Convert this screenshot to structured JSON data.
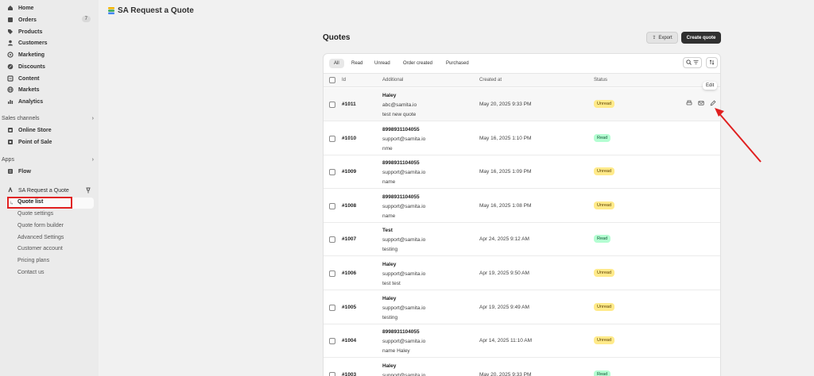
{
  "app": {
    "title": "SA Request a Quote"
  },
  "sidebar": {
    "items": [
      {
        "label": "Home",
        "icon": "home-icon"
      },
      {
        "label": "Orders",
        "icon": "orders-icon",
        "badge": "7"
      },
      {
        "label": "Products",
        "icon": "tag-icon"
      },
      {
        "label": "Customers",
        "icon": "person-icon"
      },
      {
        "label": "Marketing",
        "icon": "target-icon"
      },
      {
        "label": "Discounts",
        "icon": "discount-icon"
      },
      {
        "label": "Content",
        "icon": "content-icon"
      },
      {
        "label": "Markets",
        "icon": "globe-icon"
      },
      {
        "label": "Analytics",
        "icon": "chart-icon"
      }
    ],
    "sales_channels_label": "Sales channels",
    "sales_channels": [
      {
        "label": "Online Store",
        "icon": "store-icon"
      },
      {
        "label": "Point of Sale",
        "icon": "pos-icon"
      }
    ],
    "apps_label": "Apps",
    "apps": [
      {
        "label": "Flow",
        "icon": "flow-icon"
      }
    ],
    "app_name": "SA Request a Quote",
    "app_sub": [
      "Quote list",
      "Quote settings",
      "Quote form builder",
      "Advanced Settings",
      "Customer account",
      "Pricing plans",
      "Contact us"
    ]
  },
  "page": {
    "title": "Quotes",
    "export_label": "Export",
    "create_label": "Create quote",
    "tabs": [
      "All",
      "Read",
      "Unread",
      "Order created",
      "Purchased"
    ],
    "columns": [
      "Id",
      "Additional",
      "Created at",
      "Status"
    ],
    "tooltip": "Edit"
  },
  "rows": [
    {
      "id": "#1011",
      "line1": "Haley",
      "line2": "abc@samita.io",
      "line3": "test new quote",
      "date": "May 20, 2025 9:33 PM",
      "status": "Unread"
    },
    {
      "id": "#1010",
      "line1": "8998931104055",
      "line2": "support@samita.io",
      "line3": "nme",
      "date": "May 16, 2025 1:10 PM",
      "status": "Read"
    },
    {
      "id": "#1009",
      "line1": "8998931104055",
      "line2": "support@samita.io",
      "line3": "name",
      "date": "May 16, 2025 1:09 PM",
      "status": "Unread"
    },
    {
      "id": "#1008",
      "line1": "8998931104055",
      "line2": "support@samita.io",
      "line3": "name",
      "date": "May 16, 2025 1:08 PM",
      "status": "Unread"
    },
    {
      "id": "#1007",
      "line1": "Test",
      "line2": "support@samita.io",
      "line3": "testing",
      "date": "Apr 24, 2025 9:12 AM",
      "status": "Read"
    },
    {
      "id": "#1006",
      "line1": "Haley",
      "line2": "support@samita.io",
      "line3": "test test",
      "date": "Apr 19, 2025 9:50 AM",
      "status": "Unread"
    },
    {
      "id": "#1005",
      "line1": "Haley",
      "line2": "support@samita.io",
      "line3": "testing",
      "date": "Apr 19, 2025 9:49 AM",
      "status": "Unread"
    },
    {
      "id": "#1004",
      "line1": "8998931104055",
      "line2": "support@samita.io",
      "line3": "name Haley",
      "date": "Apr 14, 2025 11:10 AM",
      "status": "Unread"
    },
    {
      "id": "#1003",
      "line1": "Haley",
      "line2": "support@samita.io",
      "line3": "",
      "date": "May 20, 2025 9:33 PM",
      "status": "Read"
    }
  ]
}
